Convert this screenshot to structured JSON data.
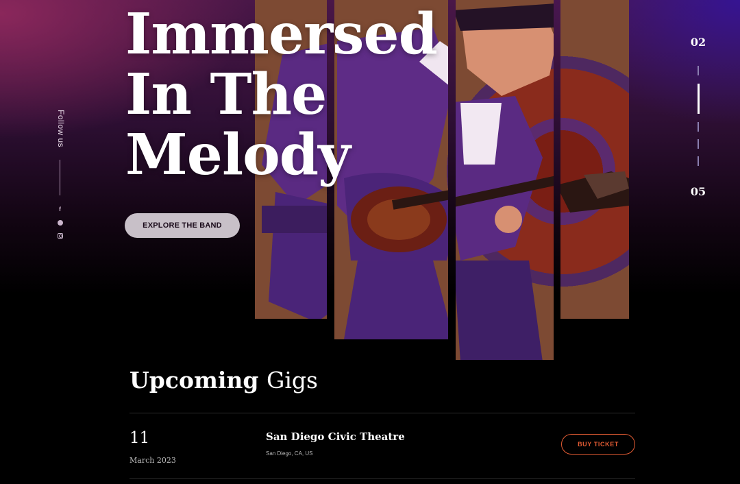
{
  "hero": {
    "headline": [
      "Immersed",
      "In The",
      "Melody"
    ],
    "explore_label": "EXPLORE THE BAND",
    "follow_label": "Follow us",
    "social": {
      "facebook_glyph": "f",
      "icons": [
        "facebook-icon",
        "spotify-icon",
        "instagram-icon"
      ]
    },
    "slider": {
      "current": "02",
      "total": "05"
    }
  },
  "gigs": {
    "title_bold": "Upcoming",
    "title_light": "Gigs",
    "items": [
      {
        "day": "11",
        "month": "March 2023",
        "venue": "San Diego Civic Theatre",
        "location": "San Diego, CA, US",
        "button_label": "BUY TICKET"
      }
    ]
  },
  "colors": {
    "accent": "#e25b33",
    "button_bg": "#c8c0c8",
    "hero_purple": "#4a1748",
    "hero_blue": "#3414a0"
  }
}
